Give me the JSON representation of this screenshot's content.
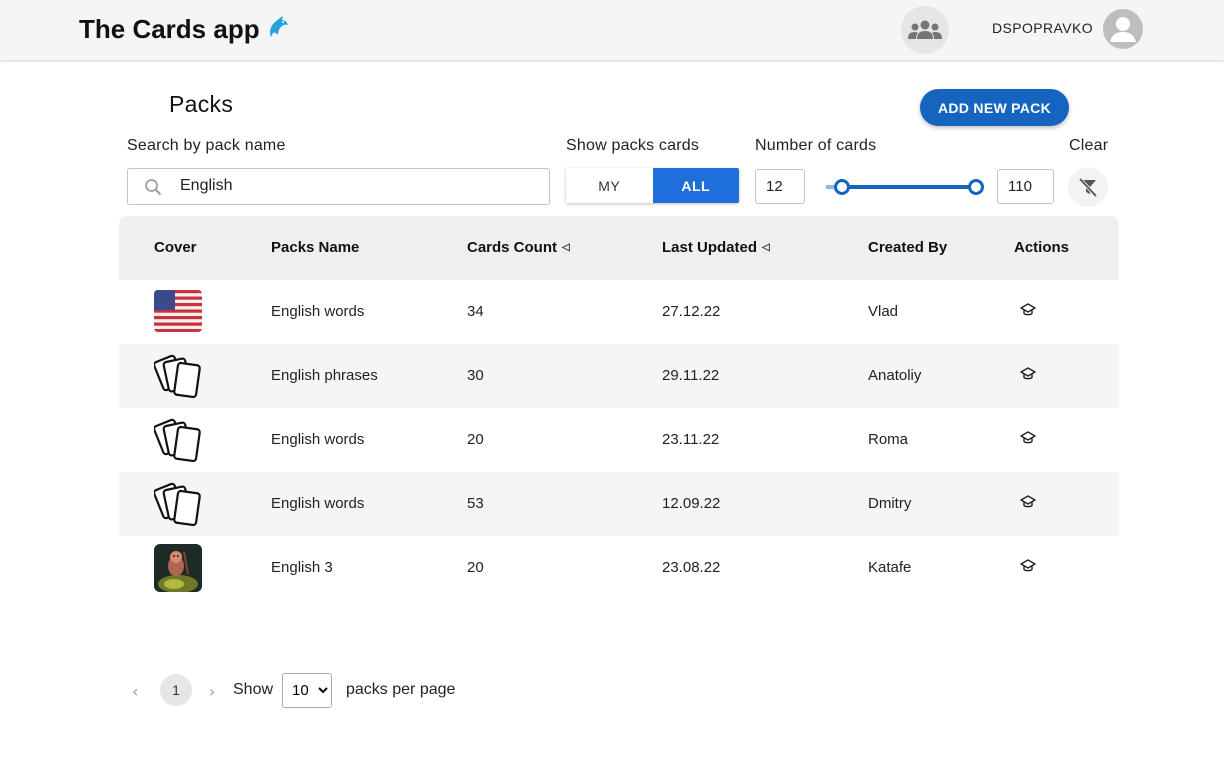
{
  "header": {
    "app_title": "The Cards app",
    "user_name": "DSPOPRAVKO"
  },
  "page": {
    "title": "Packs",
    "add_button": "ADD NEW PACK"
  },
  "filters": {
    "search_label": "Search by pack name",
    "search_value": "English",
    "show_label": "Show packs cards",
    "toggle_my": "MY",
    "toggle_all": "ALL",
    "toggle_selected": "ALL",
    "count_label": "Number of cards",
    "min_value": "12",
    "max_value": "110",
    "clear_label": "Clear"
  },
  "table": {
    "columns": [
      "Cover",
      "Packs Name",
      "Cards Count",
      "Last Updated",
      "Created By",
      "Actions"
    ],
    "rows": [
      {
        "cover": "us-flag-image",
        "name": "English words",
        "count": "34",
        "updated": "27.12.22",
        "author": "Vlad"
      },
      {
        "cover": "cards-icon",
        "name": "English phrases",
        "count": "30",
        "updated": "29.11.22",
        "author": "Anatoliy"
      },
      {
        "cover": "cards-icon",
        "name": "English words",
        "count": "20",
        "updated": "23.11.22",
        "author": "Roma"
      },
      {
        "cover": "cards-icon",
        "name": "English words",
        "count": "53",
        "updated": "12.09.22",
        "author": "Dmitry"
      },
      {
        "cover": "character-image",
        "name": "English 3",
        "count": "20",
        "updated": "23.08.22",
        "author": "Katafe"
      }
    ]
  },
  "pagination": {
    "current_page": "1",
    "show_label": "Show",
    "per_page": "10",
    "per_page_options": [
      "10"
    ],
    "suffix": "packs per page"
  },
  "colors": {
    "primary": "#1565c0",
    "toggle_active": "#1e6fd9",
    "header_bg": "#f5f5f5",
    "dolphin": "#29a3e0"
  }
}
